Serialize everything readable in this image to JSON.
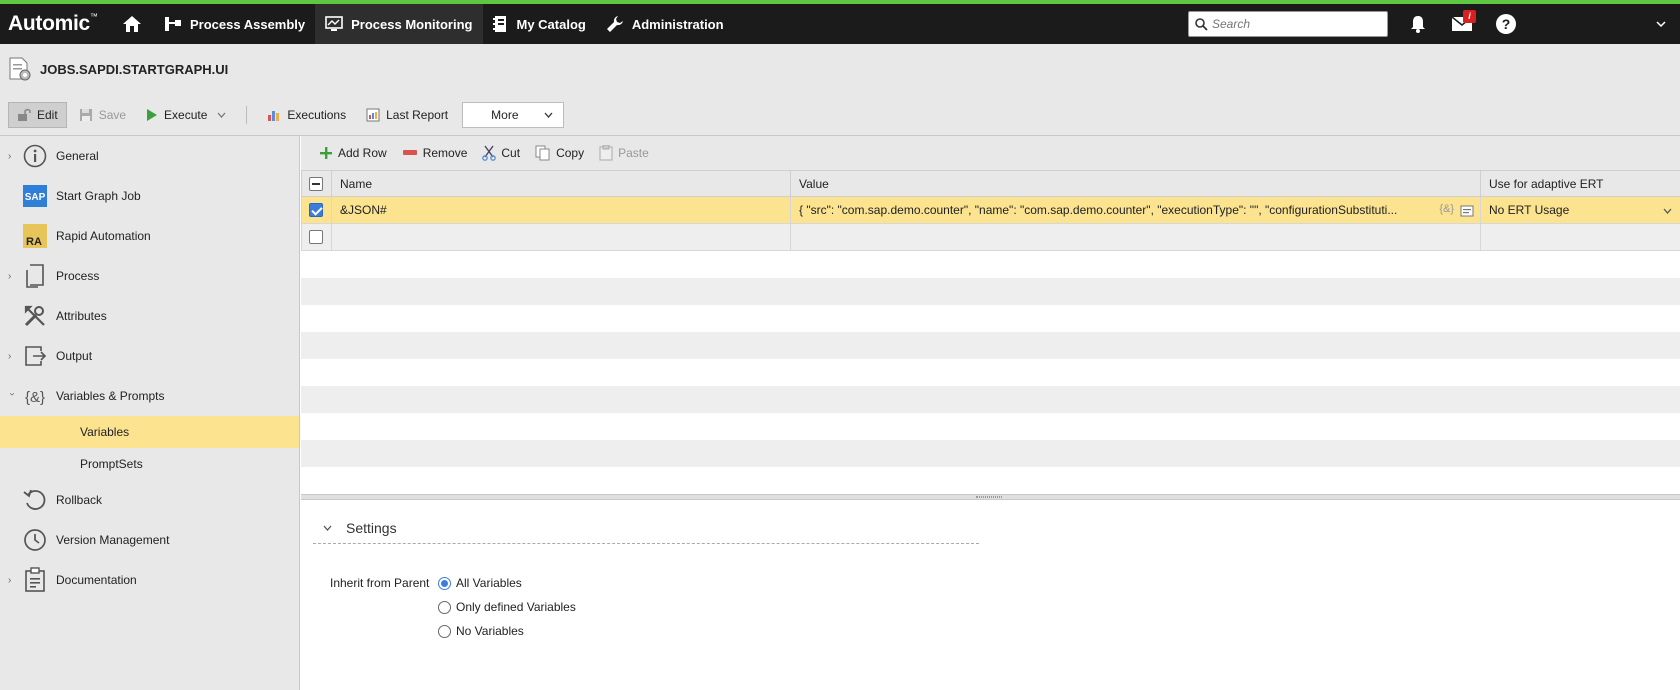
{
  "app": {
    "logo_text": "Automic",
    "nav_items": [
      {
        "label": "Process Assembly",
        "icon": "process-assembly-icon"
      },
      {
        "label": "Process Monitoring",
        "icon": "monitor-icon"
      },
      {
        "label": "My Catalog",
        "icon": "catalog-icon"
      },
      {
        "label": "Administration",
        "icon": "wrench-icon"
      }
    ],
    "search_placeholder": "Search",
    "mail_badge": "i",
    "accent_color": "#5dc742"
  },
  "object": {
    "name": "JOBS.SAPDI.STARTGRAPH.UI"
  },
  "toolbar": {
    "edit_label": "Edit",
    "save_label": "Save",
    "execute_label": "Execute",
    "executions_label": "Executions",
    "last_report_label": "Last Report",
    "more_label": "More"
  },
  "sidebar": {
    "items": [
      {
        "label": "General",
        "icon": "info-icon",
        "expandable": true
      },
      {
        "label": "Start Graph Job",
        "icon": "sap-icon",
        "expandable": false
      },
      {
        "label": "Rapid Automation",
        "icon": "ra-icon",
        "expandable": false
      },
      {
        "label": "Process",
        "icon": "process-icon",
        "expandable": true
      },
      {
        "label": "Attributes",
        "icon": "tools-icon",
        "expandable": false
      },
      {
        "label": "Output",
        "icon": "output-icon",
        "expandable": true
      },
      {
        "label": "Variables & Prompts",
        "icon": "variables-icon",
        "expandable": true,
        "expanded": true
      },
      {
        "label": "Rollback",
        "icon": "rollback-icon",
        "expandable": false
      },
      {
        "label": "Version Management",
        "icon": "clock-icon",
        "expandable": false
      },
      {
        "label": "Documentation",
        "icon": "clipboard-icon",
        "expandable": true
      }
    ],
    "sub_items": [
      {
        "label": "Variables",
        "selected": true
      },
      {
        "label": "PromptSets",
        "selected": false
      }
    ],
    "sap_icon_text": "SAP",
    "ra_icon_text": "RA",
    "variables_icon_text": "{&}"
  },
  "grid_toolbar": {
    "add_row_label": "Add Row",
    "remove_label": "Remove",
    "cut_label": "Cut",
    "copy_label": "Copy",
    "paste_label": "Paste"
  },
  "grid": {
    "columns": [
      "Name",
      "Value",
      "Use for adaptive ERT"
    ],
    "rows": [
      {
        "checked": true,
        "name": "&JSON#",
        "value": "{   \"src\": \"com.sap.demo.counter\",   \"name\": \"com.sap.demo.counter\",   \"executionType\": \"\",   \"configurationSubstituti...",
        "value_icon_text": "{&}",
        "ert": "No ERT Usage"
      },
      {
        "checked": false,
        "name": "",
        "value": "",
        "ert": ""
      }
    ]
  },
  "settings": {
    "header": "Settings",
    "inherit_label": "Inherit from Parent",
    "options": [
      {
        "label": "All Variables",
        "selected": true
      },
      {
        "label": "Only defined Variables",
        "selected": false
      },
      {
        "label": "No Variables",
        "selected": false
      }
    ]
  }
}
